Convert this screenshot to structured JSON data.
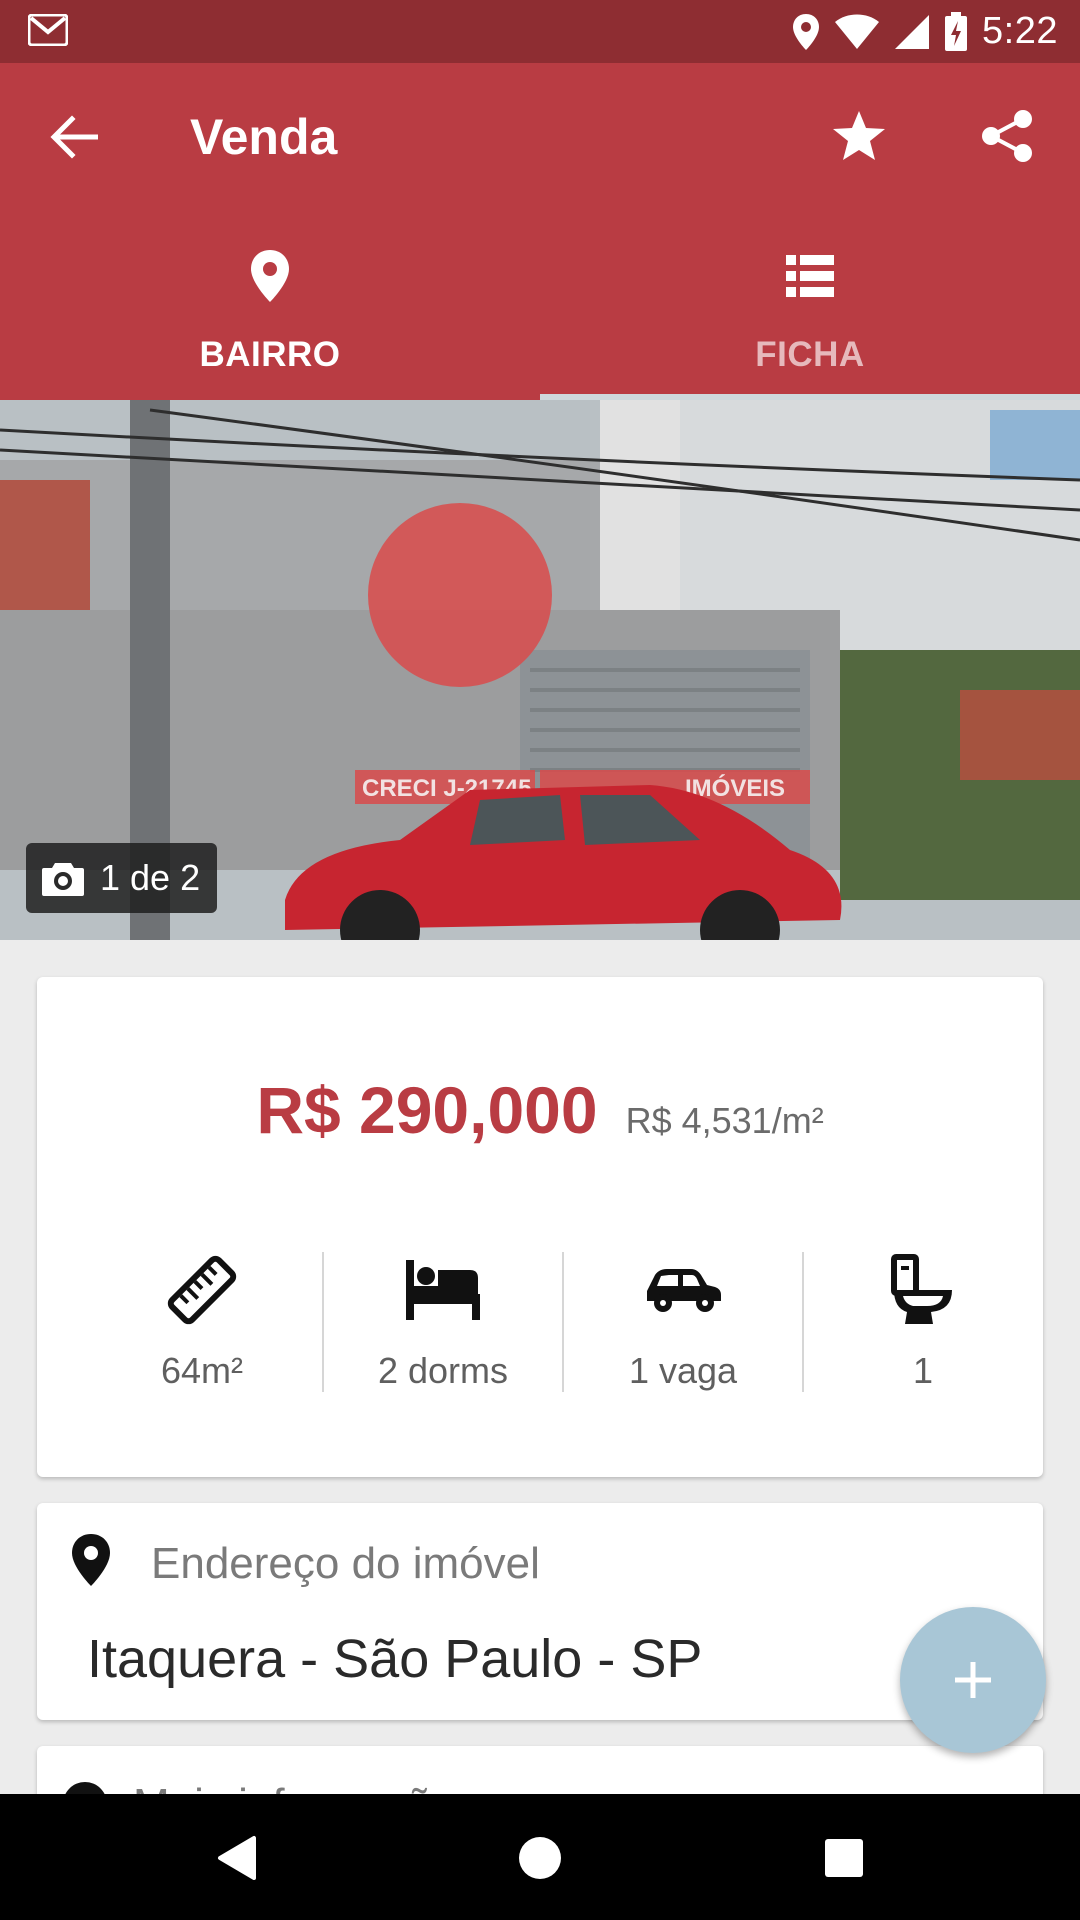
{
  "status_bar": {
    "time": "5:22",
    "icons": [
      "gmail-icon",
      "location-icon",
      "wifi-icon",
      "signal-icon",
      "battery-charging-icon"
    ]
  },
  "toolbar": {
    "title": "Venda",
    "back_icon": "arrow-back-icon",
    "favorite_icon": "star-icon",
    "share_icon": "share-icon"
  },
  "tabs": [
    {
      "label": "BAIRRO",
      "icon": "location-pin-icon",
      "active": false
    },
    {
      "label": "FICHA",
      "icon": "list-icon",
      "active": true
    }
  ],
  "photo": {
    "counter": "1 de 2",
    "watermark_lines": [
      "CRECI J-21745",
      "IMÓVEIS"
    ]
  },
  "listing": {
    "price": "R$ 290,000",
    "price_per_m2": "R$ 4,531/m²",
    "features": [
      {
        "icon": "ruler-icon",
        "label": "64m²"
      },
      {
        "icon": "bed-icon",
        "label": "2 dorms"
      },
      {
        "icon": "car-icon",
        "label": "1 vaga"
      },
      {
        "icon": "toilet-icon",
        "label": "1"
      }
    ]
  },
  "address": {
    "label": "Endereço do imóvel",
    "value": "Itaquera - São Paulo - SP"
  },
  "more_info": {
    "label": "Mais informações"
  },
  "fab": {
    "icon": "plus-icon"
  },
  "colors": {
    "app_bar": "#b93c43",
    "status_bar": "#8e2d32",
    "price": "#b93c43",
    "fab": "#a8c6d6"
  }
}
